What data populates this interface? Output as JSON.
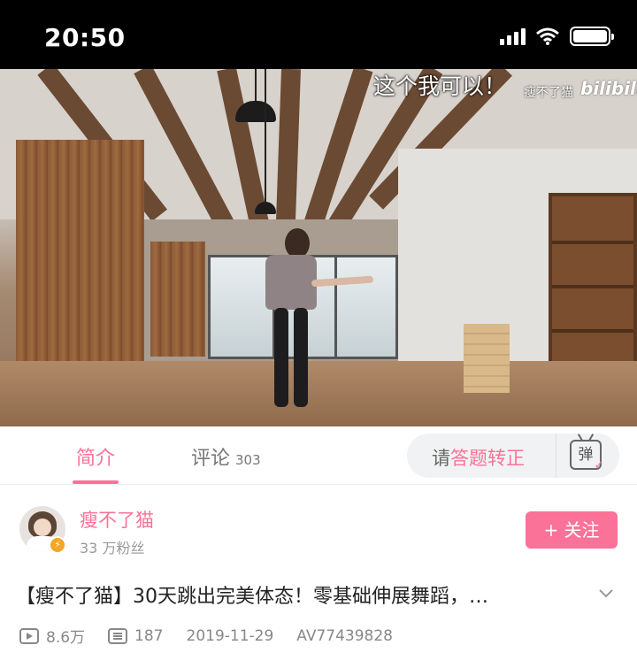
{
  "status_bar": {
    "time": "20:50"
  },
  "video": {
    "overlay_text": "这个我可以！",
    "watermark_author": "瘦不了猫",
    "watermark_brand": "bilibili"
  },
  "tabs": [
    {
      "label": "简介",
      "active": true
    },
    {
      "label": "评论",
      "count": "303",
      "active": false
    }
  ],
  "danmaku": {
    "prompt_prefix": "请",
    "prompt_accent": "答题转正",
    "icon_label": "弹"
  },
  "uploader": {
    "name": "瘦不了猫",
    "fans": "33 万粉丝",
    "follow_label": "+ 关注"
  },
  "video_info": {
    "title": "【瘦不了猫】30天跳出完美体态！零基础伸展舞蹈，…",
    "views": "8.6万",
    "danmaku_count": "187",
    "date": "2019-11-29",
    "av_id": "AV77439828"
  },
  "colors": {
    "accent": "#fb7299",
    "verify": "#f5a623"
  }
}
